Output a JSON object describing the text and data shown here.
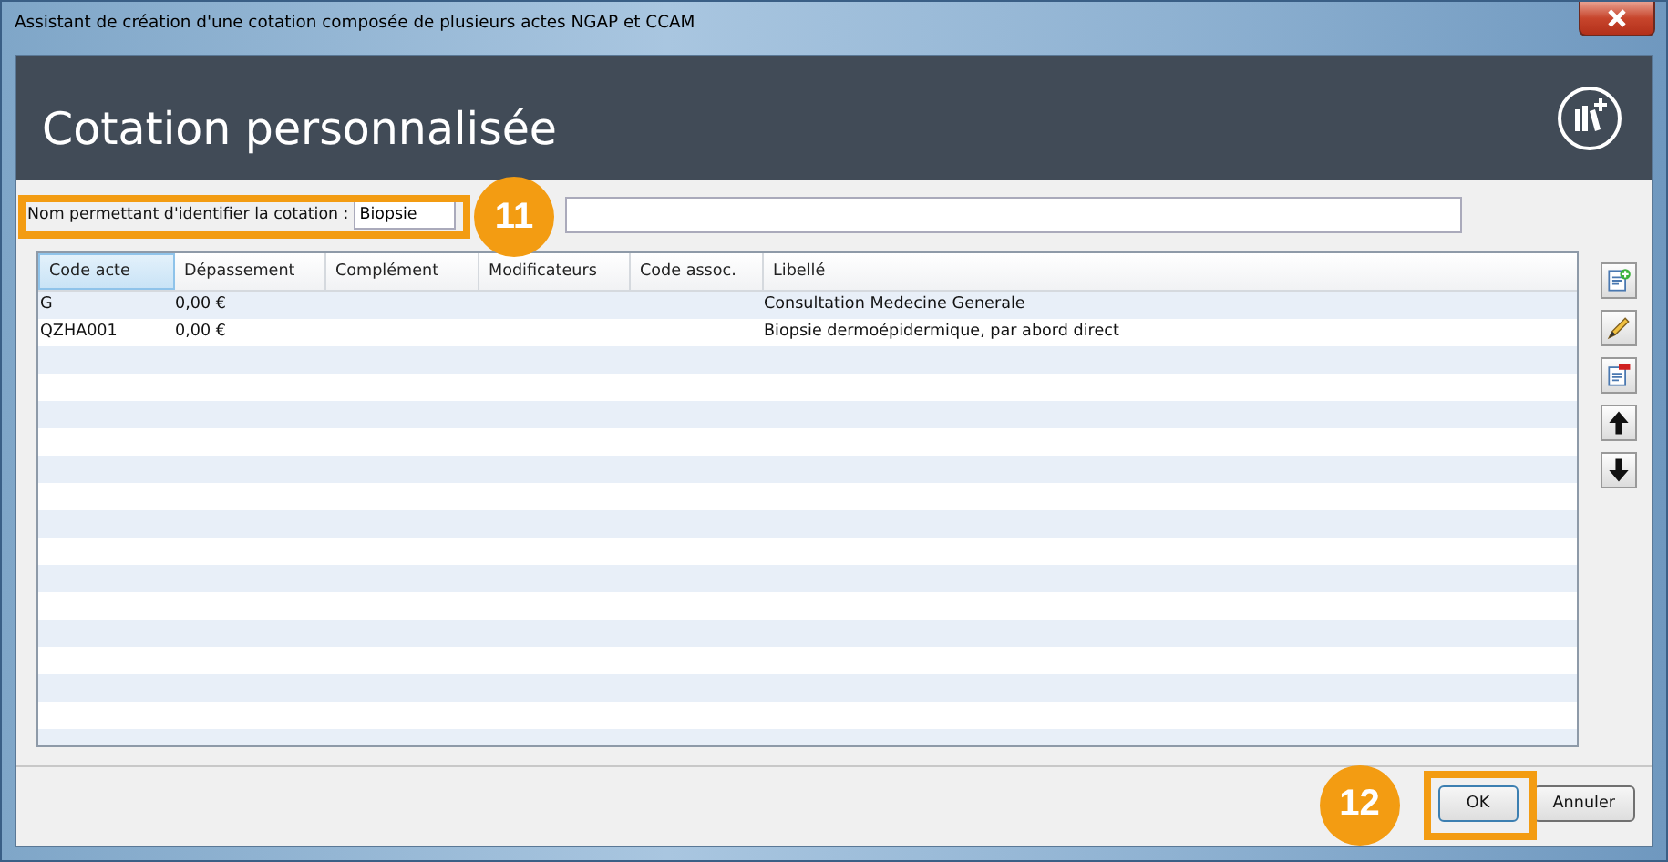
{
  "window": {
    "title": "Assistant de création d'une cotation composée de plusieurs actes NGAP et CCAM"
  },
  "header": {
    "title": "Cotation personnalisée"
  },
  "name_field": {
    "label": "Nom permettant d'identifier la cotation :",
    "value": "Biopsie",
    "callout": "11"
  },
  "table": {
    "columns": [
      {
        "label": "Code acte",
        "selected": true
      },
      {
        "label": "Dépassement",
        "selected": false
      },
      {
        "label": "Complément",
        "selected": false
      },
      {
        "label": "Modificateurs",
        "selected": false
      },
      {
        "label": "Code assoc.",
        "selected": false
      },
      {
        "label": "Libellé",
        "selected": false
      }
    ],
    "rows": [
      {
        "code_acte": "G",
        "depassement": "0,00 €",
        "libelle": "Consultation Medecine Generale"
      },
      {
        "code_acte": "QZHA001",
        "depassement": "0,00 €",
        "libelle": "Biopsie dermoépidermique, par abord direct"
      }
    ]
  },
  "side_buttons": [
    {
      "kind": "add"
    },
    {
      "kind": "edit"
    },
    {
      "kind": "delete"
    },
    {
      "kind": "up"
    },
    {
      "kind": "down"
    }
  ],
  "buttons": [
    {
      "label": "OK",
      "default": true,
      "callout": "12"
    },
    {
      "label": "Annuler",
      "default": false
    }
  ]
}
